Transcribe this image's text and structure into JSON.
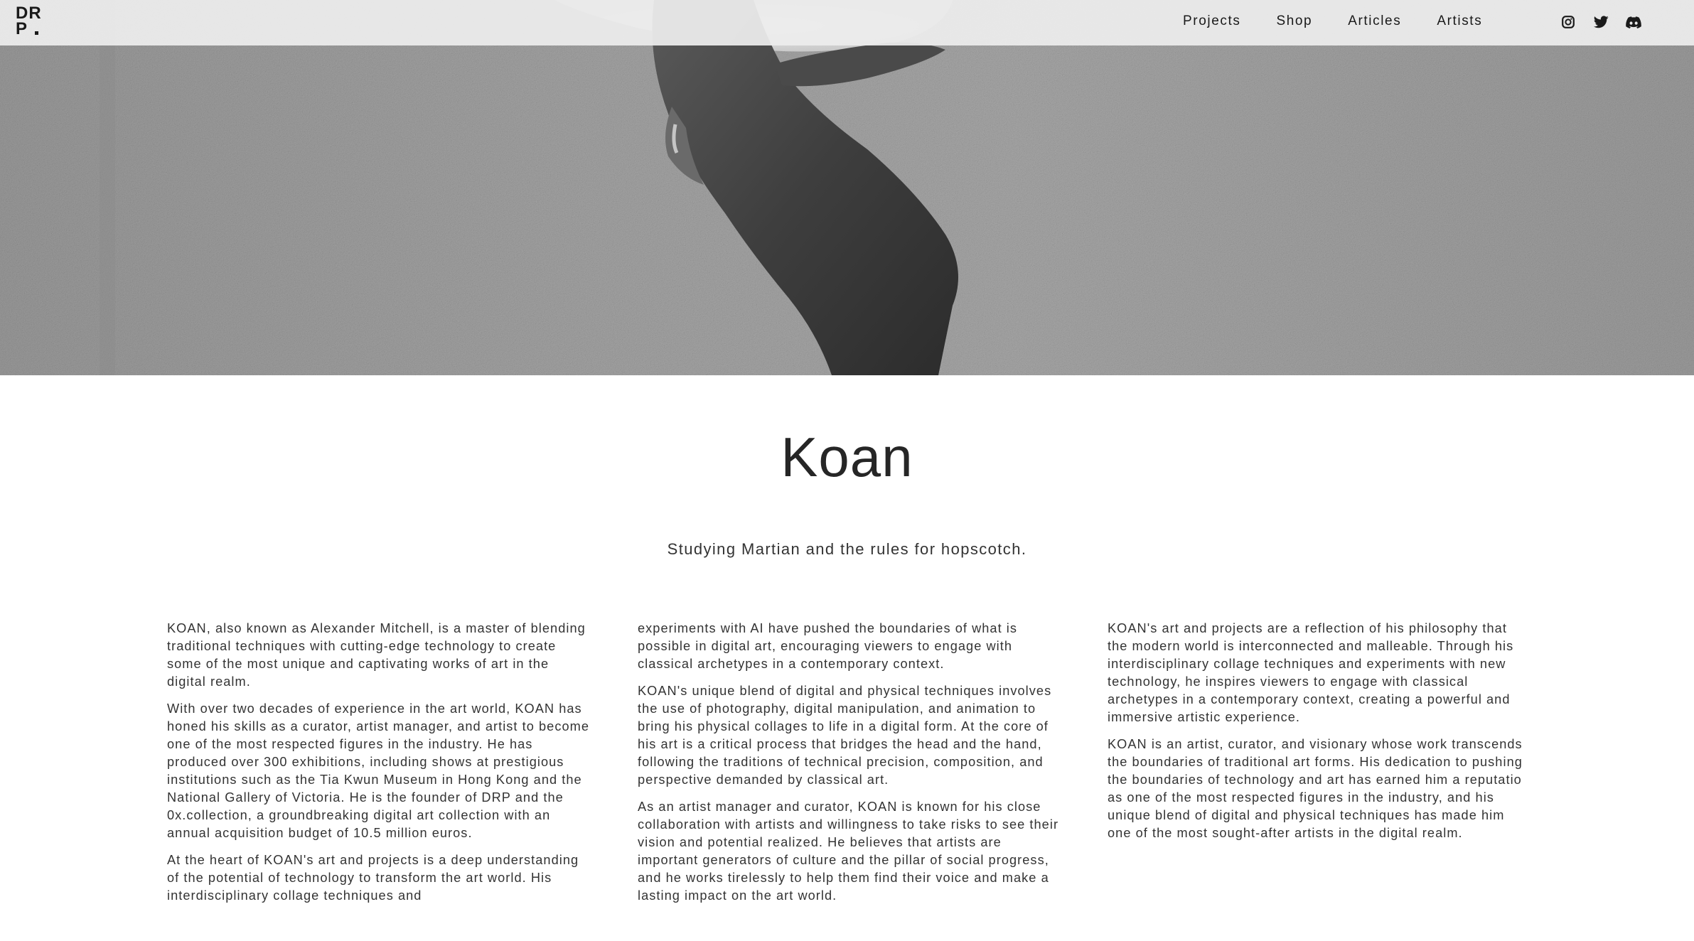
{
  "header": {
    "logo_line1": "DR",
    "logo_line2": "P",
    "nav": [
      "Projects",
      "Shop",
      "Articles",
      "Artists"
    ],
    "social_icons": [
      "instagram-icon",
      "twitter-icon",
      "discord-icon"
    ]
  },
  "artist": {
    "name": "Koan",
    "tagline": "Studying Martian and the rules for hopscotch."
  },
  "bio": {
    "col1": [
      "KOAN, also known as Alexander Mitchell, is a master of blending traditional techniques with cutting-edge technology to create some of the most unique and captivating works of art in the digital realm.",
      "With over two decades of experience in the art world, KOAN has honed his skills as a curator, artist manager, and artist to become one of the most respected figures in the industry. He has produced over 300 exhibitions, including shows at prestigious institutions such as the Tia Kwun Museum in Hong Kong and the National Gallery of Victoria. He is the founder of DRP and the 0x.collection, a groundbreaking digital art collection with an annual acquisition budget of 10.5 million euros.",
      "At the heart of KOAN's art and projects is a deep understanding of the potential of technology to transform the art world. His interdisciplinary collage techniques and"
    ],
    "col2": [
      "experiments with AI have pushed the boundaries of what is possible in digital art, encouraging viewers to engage with classical archetypes in a contemporary context.",
      "KOAN's unique blend of digital and physical techniques involves the use of photography, digital manipulation, and animation to bring his physical collages to life in a digital form. At the core of his art is a critical process that bridges the head and the hand, following the traditions of technical precision, composition, and perspective demanded by classical art.",
      "As an artist manager and curator, KOAN is known for his close collaboration with artists and willingness to take risks to see their vision and potential realized. He believes that artists are important generators of culture and the pillar of social progress, and he works tirelessly to help them find their voice and make a lasting impact on the art world."
    ],
    "col3": [
      "KOAN's art and projects are a reflection of his philosophy that the modern world is interconnected and malleable. Through his interdisciplinary collage techniques and experiments with new technology, he inspires viewers to engage with classical archetypes in a contemporary context, creating a powerful and immersive artistic experience.",
      "KOAN is an artist, curator, and visionary whose work transcends the boundaries of traditional art forms. His dedication to pushing the boundaries of technology and art has earned him a reputation as one of the most respected figures in the industry, and his unique blend of digital and physical techniques has made him one of the most sought-after artists in the digital realm."
    ]
  }
}
